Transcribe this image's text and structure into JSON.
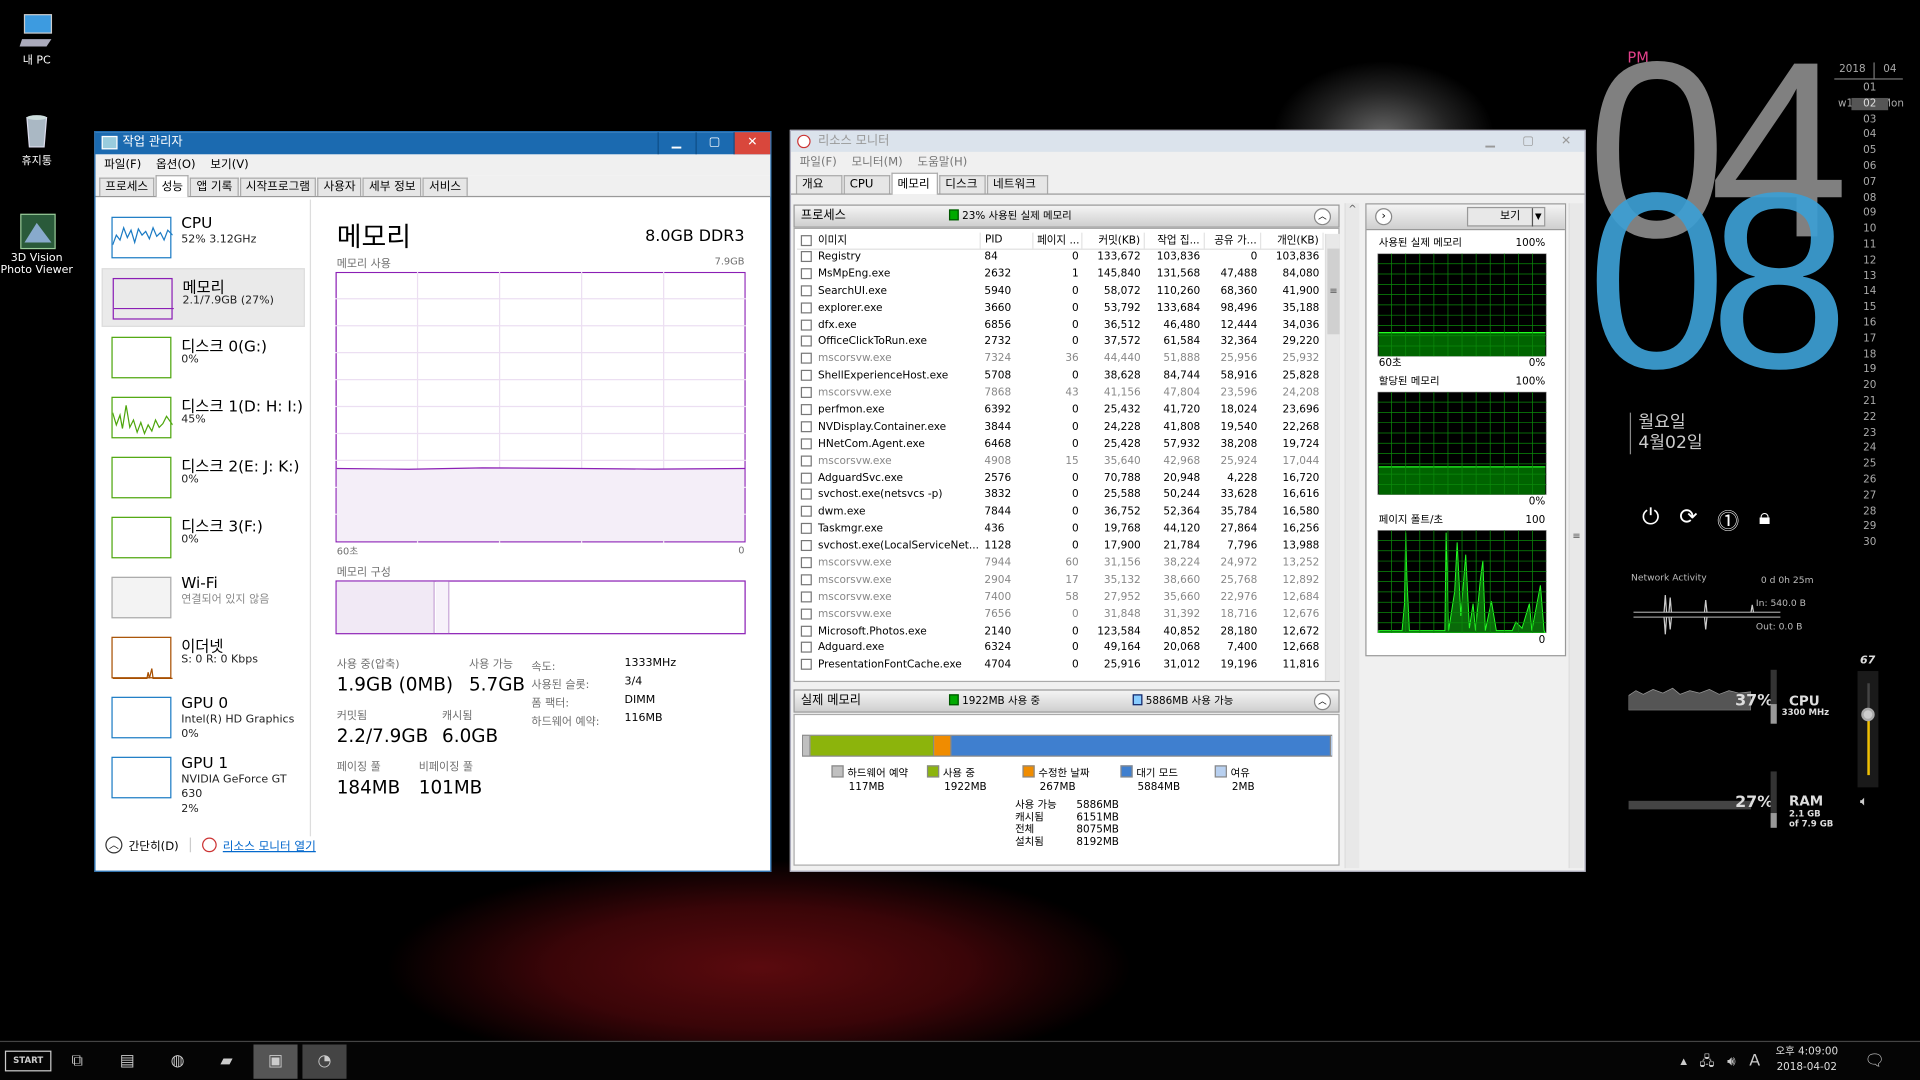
{
  "desktop": {
    "icons": [
      {
        "label": "내 PC",
        "icon": "computer-icon"
      },
      {
        "label": "휴지통",
        "icon": "recycle-bin-icon"
      },
      {
        "label": "3D Vision Photo Viewer",
        "icon": "photo-viewer-icon"
      }
    ]
  },
  "task_manager": {
    "title": "작업 관리자",
    "menu": [
      "파일(F)",
      "옵션(O)",
      "보기(V)"
    ],
    "tabs": [
      "프로세스",
      "성능",
      "앱 기록",
      "시작프로그램",
      "사용자",
      "세부 정보",
      "서비스"
    ],
    "selected_tab": "성능",
    "sidebar": [
      {
        "name": "CPU",
        "sub": "52% 3.12GHz",
        "color": "#1b7bc4"
      },
      {
        "name": "메모리",
        "sub": "2.1/7.9GB (27%)",
        "color": "#8b1fb5",
        "selected": true
      },
      {
        "name": "디스크 0(G:)",
        "sub": "0%",
        "color": "#4da60c"
      },
      {
        "name": "디스크 1(D: H: I:)",
        "sub": "45%",
        "color": "#4da60c"
      },
      {
        "name": "디스크 2(E: J: K:)",
        "sub": "0%",
        "color": "#4da60c"
      },
      {
        "name": "디스크 3(F:)",
        "sub": "0%",
        "color": "#4da60c"
      },
      {
        "name": "Wi-Fi",
        "sub": "연결되어 있지 않음",
        "color": "#aaaaaa"
      },
      {
        "name": "이더넷",
        "sub": "S: 0 R: 0 Kbps",
        "color": "#a74f01"
      },
      {
        "name": "GPU 0",
        "sub": "Intel(R) HD Graphics",
        "sub2": "0%",
        "color": "#1b7bc4"
      },
      {
        "name": "GPU 1",
        "sub": "NVIDIA GeForce GT 630",
        "sub2": "2%",
        "color": "#1b7bc4"
      }
    ],
    "main": {
      "title": "메모리",
      "spec": "8.0GB DDR3",
      "usage_label": "메모리 사용",
      "usage_max": "7.9GB",
      "axis_left": "60초",
      "axis_right": "0",
      "composition_label": "메모리 구성",
      "usage_percent": 27,
      "stats": [
        {
          "label": "사용 중(압축)",
          "value": "1.9GB (0MB)"
        },
        {
          "label": "사용 가능",
          "value": "5.7GB"
        },
        {
          "label": "커밋됨",
          "value": "2.2/7.9GB"
        },
        {
          "label": "캐시됨",
          "value": "6.0GB"
        },
        {
          "label": "페이징 풀",
          "value": "184MB"
        },
        {
          "label": "비페이징 풀",
          "value": "101MB"
        }
      ],
      "details": [
        {
          "k": "속도:",
          "v": "1333MHz"
        },
        {
          "k": "사용된 슬롯:",
          "v": "3/4"
        },
        {
          "k": "폼 팩터:",
          "v": "DIMM"
        },
        {
          "k": "하드웨어 예약:",
          "v": "116MB"
        }
      ]
    },
    "footer": {
      "collapse": "간단히(D)",
      "link": "리소스 모니터 열기"
    }
  },
  "resource_monitor": {
    "title": "리소스 모니터",
    "menu": [
      "파일(F)",
      "모니터(M)",
      "도움말(H)"
    ],
    "tabs": [
      "개요",
      "CPU",
      "메모리",
      "디스크",
      "네트워크"
    ],
    "selected_tab": "메모리",
    "process_header": "프로세스",
    "process_status": "23% 사용된 실제 메모리",
    "columns": [
      "이미지",
      "PID",
      "페이지 ...",
      "커밋(KB)",
      "작업 집...",
      "공유 가...",
      "개인(KB)"
    ],
    "processes": [
      [
        "Registry",
        "84",
        "0",
        "133,672",
        "103,836",
        "0",
        "103,836",
        false
      ],
      [
        "MsMpEng.exe",
        "2632",
        "1",
        "145,840",
        "131,568",
        "47,488",
        "84,080",
        false
      ],
      [
        "SearchUI.exe",
        "5940",
        "0",
        "58,072",
        "110,260",
        "68,360",
        "41,900",
        false
      ],
      [
        "explorer.exe",
        "3660",
        "0",
        "53,792",
        "133,684",
        "98,496",
        "35,188",
        false
      ],
      [
        "dfx.exe",
        "6856",
        "0",
        "36,512",
        "46,480",
        "12,444",
        "34,036",
        false
      ],
      [
        "OfficeClickToRun.exe",
        "2732",
        "0",
        "37,572",
        "61,584",
        "32,364",
        "29,220",
        false
      ],
      [
        "mscorsvw.exe",
        "7324",
        "36",
        "44,440",
        "51,888",
        "25,956",
        "25,932",
        true
      ],
      [
        "ShellExperienceHost.exe",
        "5708",
        "0",
        "38,628",
        "84,744",
        "58,916",
        "25,828",
        false
      ],
      [
        "mscorsvw.exe",
        "7868",
        "43",
        "41,156",
        "47,804",
        "23,596",
        "24,208",
        true
      ],
      [
        "perfmon.exe",
        "6392",
        "0",
        "25,432",
        "41,720",
        "18,024",
        "23,696",
        false
      ],
      [
        "NVDisplay.Container.exe",
        "3844",
        "0",
        "24,228",
        "41,808",
        "19,540",
        "22,268",
        false
      ],
      [
        "HNetCom.Agent.exe",
        "6468",
        "0",
        "25,428",
        "57,932",
        "38,208",
        "19,724",
        false
      ],
      [
        "mscorsvw.exe",
        "4908",
        "15",
        "35,640",
        "42,968",
        "25,924",
        "17,044",
        true
      ],
      [
        "AdguardSvc.exe",
        "2576",
        "0",
        "70,788",
        "20,948",
        "4,228",
        "16,720",
        false
      ],
      [
        "svchost.exe(netsvcs -p)",
        "3832",
        "0",
        "25,588",
        "50,244",
        "33,628",
        "16,616",
        false
      ],
      [
        "dwm.exe",
        "7844",
        "0",
        "36,752",
        "52,364",
        "35,784",
        "16,580",
        false
      ],
      [
        "Taskmgr.exe",
        "436",
        "0",
        "19,768",
        "44,120",
        "27,864",
        "16,256",
        false
      ],
      [
        "svchost.exe(LocalServiceNet...",
        "1128",
        "0",
        "17,900",
        "21,784",
        "7,796",
        "13,988",
        false
      ],
      [
        "mscorsvw.exe",
        "7944",
        "60",
        "31,156",
        "38,224",
        "24,972",
        "13,252",
        true
      ],
      [
        "mscorsvw.exe",
        "2904",
        "17",
        "35,132",
        "38,660",
        "25,768",
        "12,892",
        true
      ],
      [
        "mscorsvw.exe",
        "7400",
        "58",
        "27,952",
        "35,660",
        "22,976",
        "12,684",
        true
      ],
      [
        "mscorsvw.exe",
        "7656",
        "0",
        "31,848",
        "31,392",
        "18,716",
        "12,676",
        true
      ],
      [
        "Microsoft.Photos.exe",
        "2140",
        "0",
        "123,584",
        "40,852",
        "28,180",
        "12,672",
        false
      ],
      [
        "Adguard.exe",
        "6324",
        "0",
        "49,164",
        "20,068",
        "7,400",
        "12,668",
        false
      ],
      [
        "PresentationFontCache.exe",
        "4704",
        "0",
        "25,916",
        "31,012",
        "19,196",
        "11,816",
        false
      ]
    ],
    "physical": {
      "header": "실제 메모리",
      "in_use": "1922MB 사용 중",
      "available": "5886MB 사용 가능",
      "segments": [
        {
          "label": "하드웨어 예약",
          "value": "117MB",
          "mb": 117,
          "color": "#c0c0c0"
        },
        {
          "label": "사용 중",
          "value": "1922MB",
          "mb": 1922,
          "color": "#8cb40c"
        },
        {
          "label": "수정한 날짜",
          "value": "267MB",
          "mb": 267,
          "color": "#f08c00"
        },
        {
          "label": "대기 모드",
          "value": "5884MB",
          "mb": 5884,
          "color": "#3f7fcf"
        },
        {
          "label": "여유",
          "value": "2MB",
          "mb": 2,
          "color": "#b8d0f0"
        }
      ],
      "summary": [
        {
          "k": "사용 가능",
          "v": "5886MB"
        },
        {
          "k": "캐시됨",
          "v": "6151MB"
        },
        {
          "k": "전체",
          "v": "8075MB"
        },
        {
          "k": "설치됨",
          "v": "8192MB"
        }
      ]
    },
    "graphs": {
      "view_label": "보기",
      "items": [
        {
          "title": "사용된 실제 메모리",
          "max": "100%",
          "min": "0%",
          "left": "60초",
          "level": 23
        },
        {
          "title": "할당된 메모리",
          "max": "100%",
          "min": "0%",
          "level": 27
        },
        {
          "title": "페이지 폴트/초",
          "max": "100",
          "min": "0"
        }
      ]
    }
  },
  "clock": {
    "ampm": "PM",
    "hour": "04",
    "minute": "08",
    "weekday": "월요일",
    "date": "4월02일",
    "calendar": {
      "year": "2018",
      "month": "04",
      "week": "w15",
      "weekday": "Mon",
      "today": "02",
      "days": [
        "01",
        "02",
        "03",
        "04",
        "05",
        "06",
        "07",
        "08",
        "09",
        "10",
        "11",
        "12",
        "13",
        "14",
        "15",
        "16",
        "17",
        "18",
        "19",
        "20",
        "21",
        "22",
        "23",
        "24",
        "25",
        "26",
        "27",
        "28",
        "29",
        "30"
      ]
    }
  },
  "system_widget": {
    "network_title": "Network Activity",
    "uptime": "0 d 0h 25m",
    "net_in": "In: 540.0 B",
    "net_out": "Out: 0.0 B",
    "cpu_percent": "37%",
    "cpu_label": "CPU",
    "cpu_freq": "3300 MHz",
    "ram_percent": "27%",
    "ram_label": "RAM",
    "ram_used": "2.1 GB",
    "ram_total": "of 7.9 GB",
    "volume": "67"
  },
  "taskbar": {
    "start": "START",
    "time": "오후 4:09:00",
    "date": "2018-04-02",
    "ime": "A"
  }
}
